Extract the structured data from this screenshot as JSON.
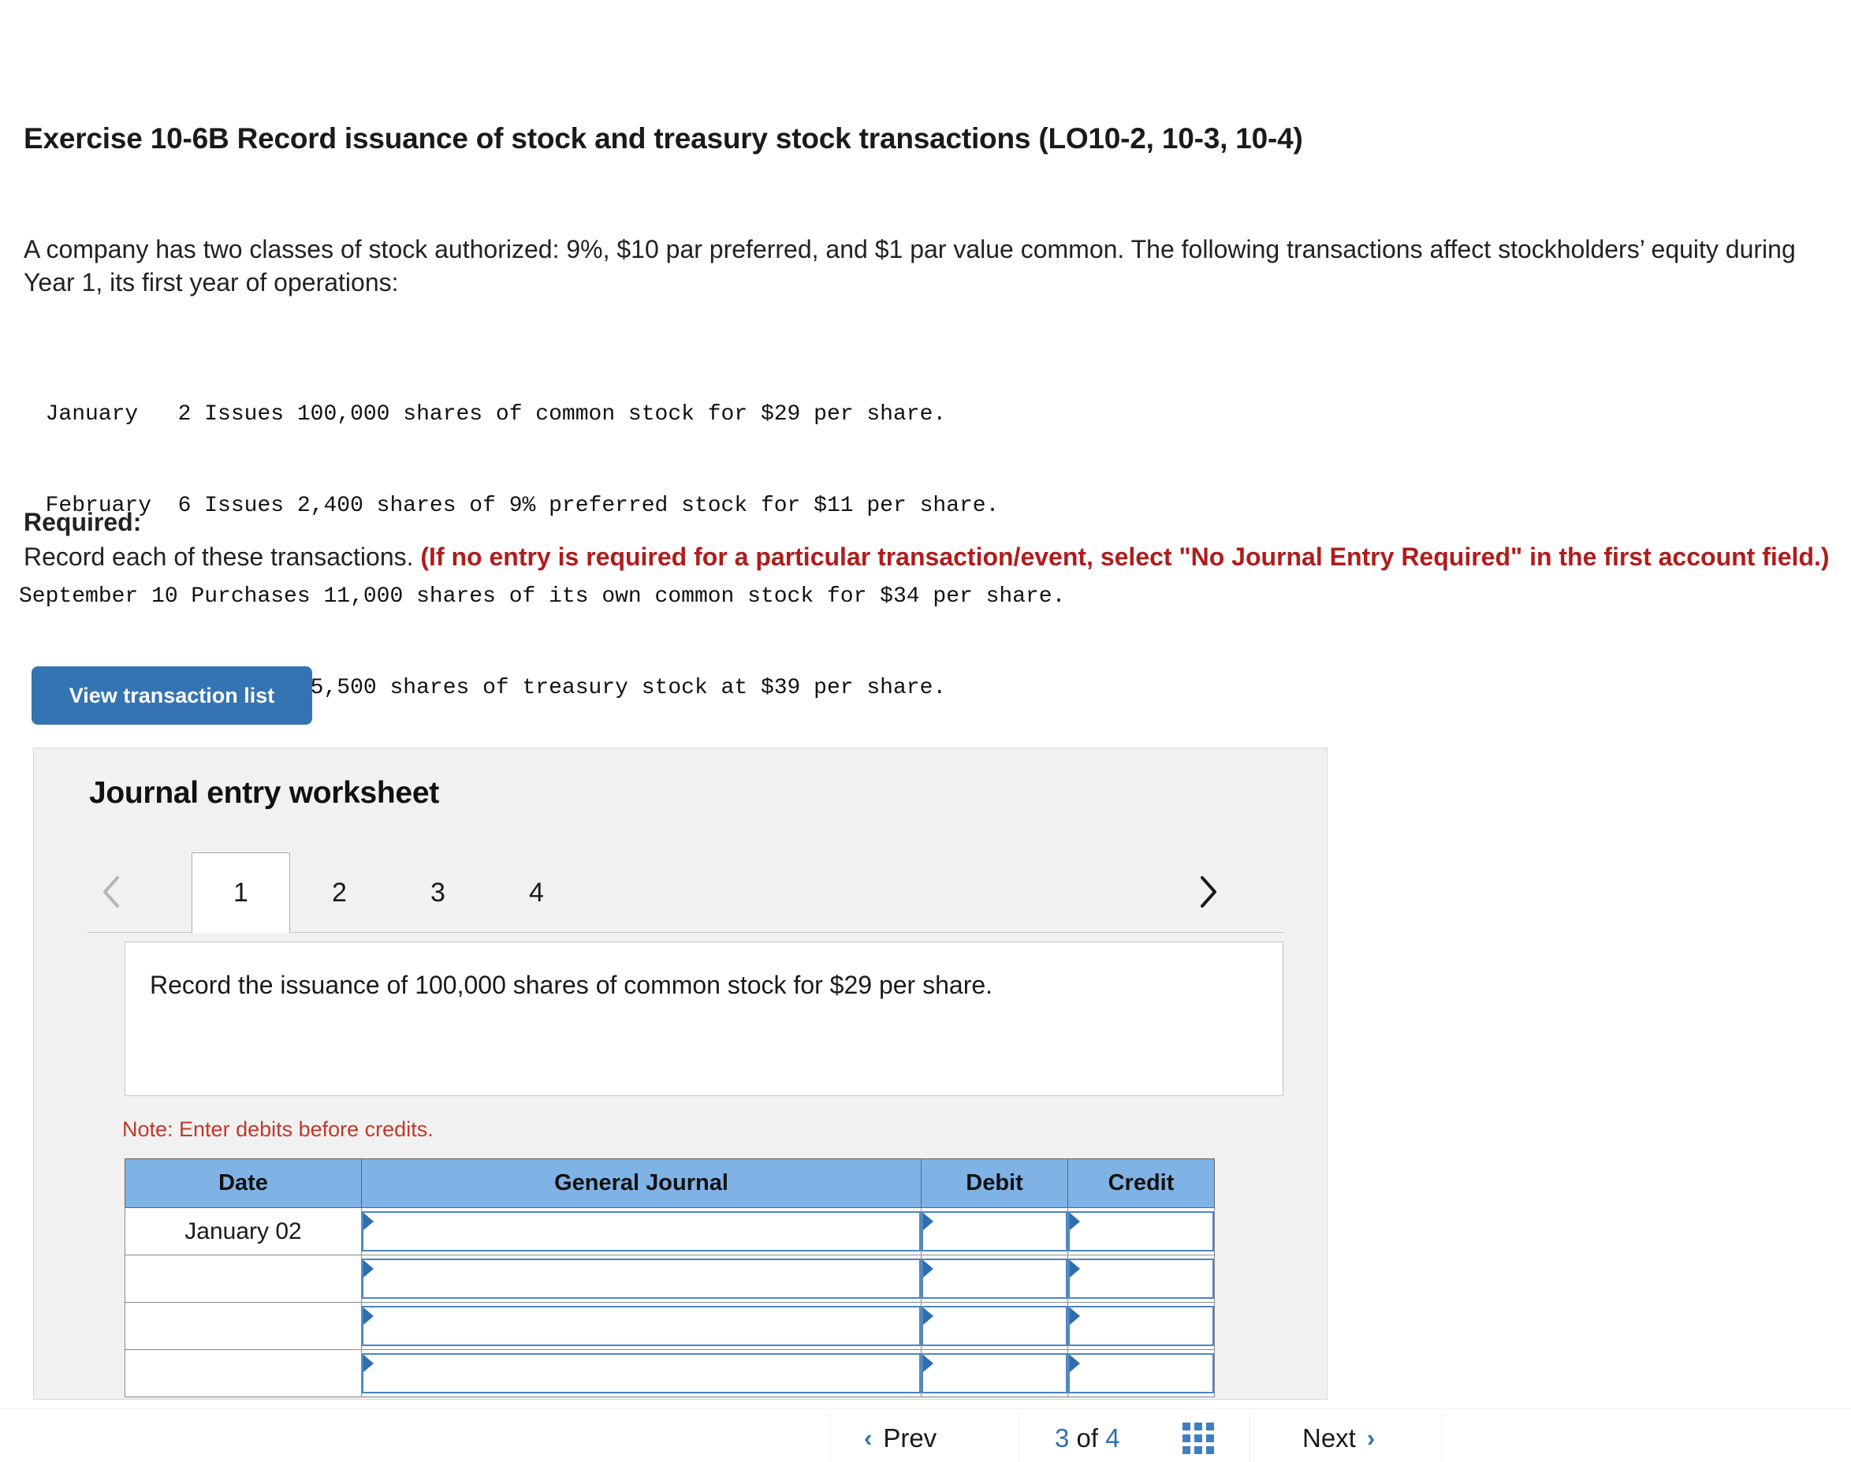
{
  "exercise": {
    "title": "Exercise 10-6B Record issuance of stock and treasury stock transactions (LO10-2, 10-3, 10-4)",
    "intro": "A company has two classes of stock authorized: 9%, $10 par preferred, and $1 par value common. The following transactions affect stockholders’ equity during Year 1, its first year of operations:",
    "transactions": [
      "  January   2 Issues 100,000 shares of common stock for $29 per share.",
      "  February  6 Issues 2,400 shares of 9% preferred stock for $11 per share.",
      "September 10 Purchases 11,000 shares of its own common stock for $34 per share.",
      "  December 15 Resells 5,500 shares of treasury stock at $39 per share."
    ],
    "required_label": "Required:",
    "required_text": "Record each of these transactions. ",
    "required_emphasis": "(If no entry is required for a particular transaction/event, select \"No Journal Entry Required\" in the first account field.)"
  },
  "toolbar": {
    "view_transaction_list": "View transaction list"
  },
  "worksheet": {
    "title": "Journal entry worksheet",
    "prev_arrow": "‹",
    "next_arrow": "›",
    "tabs": [
      {
        "label": "1",
        "active": true
      },
      {
        "label": "2",
        "active": false
      },
      {
        "label": "3",
        "active": false
      },
      {
        "label": "4",
        "active": false
      }
    ],
    "instruction": "Record the issuance of 100,000 shares of common stock for $29 per share.",
    "note": "Note: Enter debits before credits.",
    "table": {
      "headers": [
        "Date",
        "General Journal",
        "Debit",
        "Credit"
      ],
      "rows": [
        {
          "date": "January 02",
          "general_journal": "",
          "debit": "",
          "credit": ""
        },
        {
          "date": "",
          "general_journal": "",
          "debit": "",
          "credit": ""
        },
        {
          "date": "",
          "general_journal": "",
          "debit": "",
          "credit": ""
        },
        {
          "date": "",
          "general_journal": "",
          "debit": "",
          "credit": ""
        }
      ]
    }
  },
  "bottom_nav": {
    "prev_label": "Prev",
    "prev_chevron": "‹",
    "page_current": "3",
    "page_of": " of ",
    "page_total": "4",
    "grid_icon": "grid-icon",
    "next_label": "Next",
    "next_chevron": "›"
  },
  "colors": {
    "button_blue": "#3574b2",
    "table_header_blue": "#7fb2e5",
    "field_border_blue": "#4a86c5",
    "note_red": "#c0392b",
    "required_red": "#b01c1c",
    "panel_gray": "#f1f1f1"
  }
}
